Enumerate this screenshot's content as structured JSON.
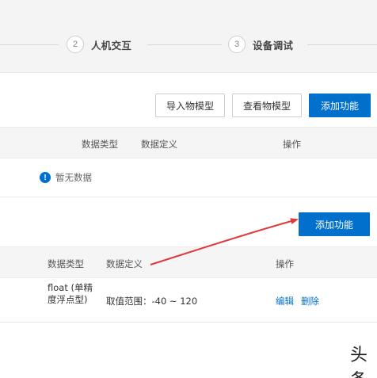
{
  "steps": [
    {
      "num": "2",
      "label": "人机交互"
    },
    {
      "num": "3",
      "label": "设备调试"
    }
  ],
  "toolbar": {
    "import_label": "导入物模型",
    "view_label": "查看物模型",
    "add_label": "添加功能"
  },
  "table1": {
    "headers": {
      "data_type": "数据类型",
      "data_def": "数据定义",
      "action": "操作"
    },
    "empty_text": "暂无数据",
    "empty_icon": "!"
  },
  "section2": {
    "add_label": "添加功能",
    "headers": {
      "data_type": "数据类型",
      "data_def": "数据定义",
      "action": "操作"
    },
    "rows": [
      {
        "data_type": "float (单精度浮点型)",
        "data_def": "取值范围：-40 ~ 120",
        "edit": "编辑",
        "delete": "删除"
      }
    ]
  },
  "annotation": {
    "arrow_color": "#e03a3a"
  },
  "watermark": "头条",
  "colors": {
    "primary": "#0070cc",
    "link": "#0070cc"
  }
}
